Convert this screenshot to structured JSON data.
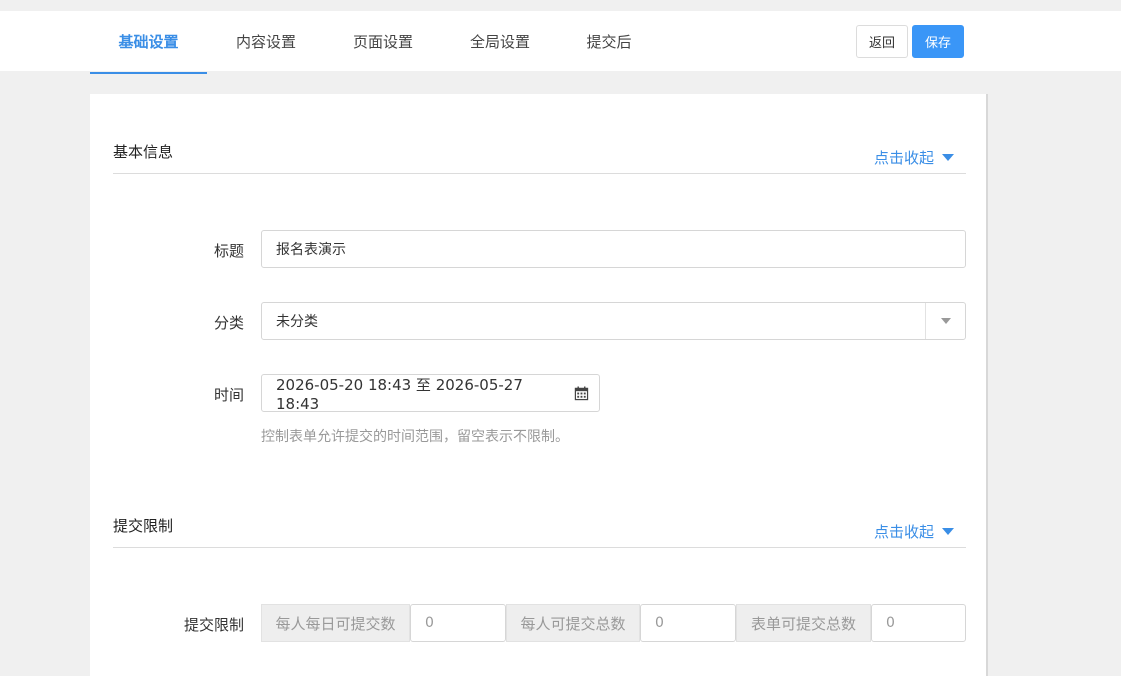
{
  "tabs": [
    {
      "label": "基础设置",
      "active": true
    },
    {
      "label": "内容设置",
      "active": false
    },
    {
      "label": "页面设置",
      "active": false
    },
    {
      "label": "全局设置",
      "active": false
    },
    {
      "label": "提交后",
      "active": false
    }
  ],
  "actions": {
    "back_label": "返回",
    "save_label": "保存"
  },
  "colors": {
    "accent": "#3a8ee6",
    "save_button": "#3a96f7",
    "background": "#f0f0f0"
  },
  "basic_info": {
    "title": "基本信息",
    "toggle": "点击收起",
    "fields": {
      "title": {
        "label": "标题",
        "value": "报名表演示"
      },
      "category": {
        "label": "分类",
        "value": "未分类"
      },
      "time": {
        "label": "时间",
        "value": "2026-05-20 18:43 至 2026-05-27 18:43",
        "help": "控制表单允许提交的时间范围，留空表示不限制。"
      }
    }
  },
  "submit_limit": {
    "title": "提交限制",
    "toggle": "点击收起",
    "label": "提交限制",
    "daily_per_person": {
      "label": "每人每日可提交数",
      "value": "0"
    },
    "total_per_person": {
      "label": "每人可提交总数",
      "value": "0"
    },
    "form_total": {
      "label": "表单可提交总数",
      "value": "0"
    }
  },
  "icons": {
    "calendar": "calendar-icon",
    "dropdown": "chevron-down-icon",
    "collapse": "caret-down-icon"
  }
}
